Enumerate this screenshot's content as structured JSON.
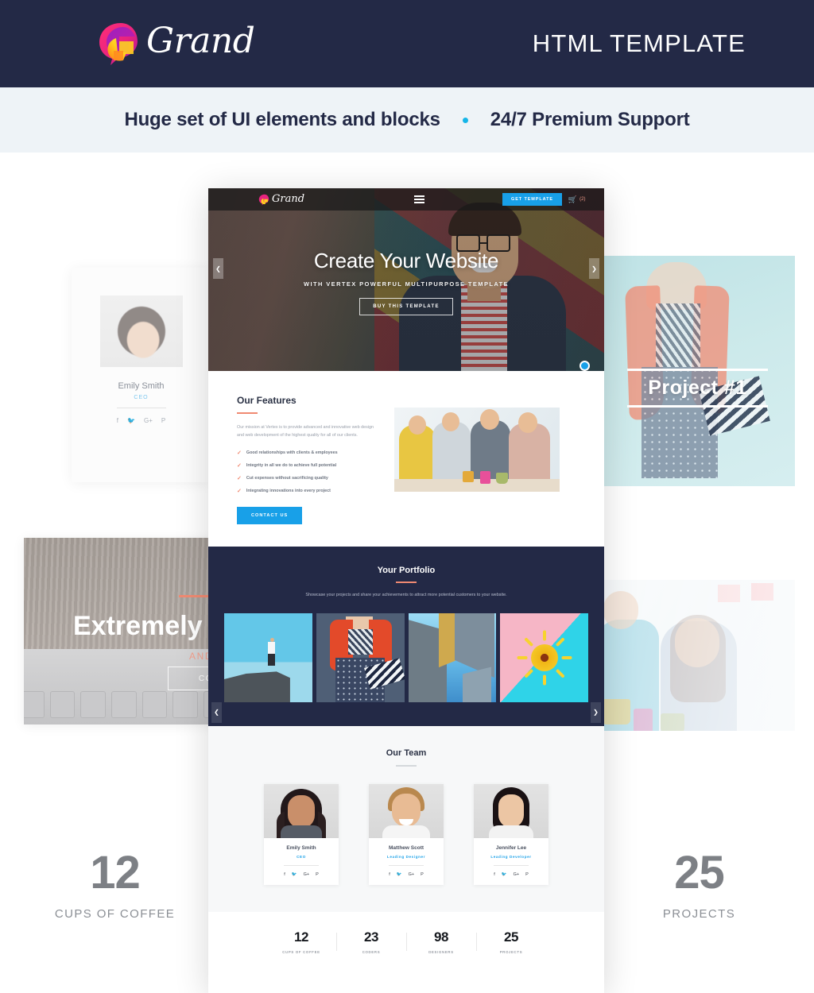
{
  "banner": {
    "brand_name": "Grand",
    "brand_icon": "grand-logo-icon",
    "tagline": "HTML TEMPLATE",
    "bg_color": "#232946"
  },
  "sub_banner": {
    "left_text": "Huge set of UI elements and blocks",
    "separator_icon": "bullet-dot-icon",
    "right_text": "24/7 Premium Support",
    "bg_color": "#eef3f7",
    "dot_color": "#16b5e8"
  },
  "background": {
    "team_card": {
      "name": "Emily Smith",
      "role": "CEO",
      "social": [
        "f",
        "𝕏",
        "G+",
        "P"
      ]
    },
    "project_card": {
      "label": "Project #1"
    },
    "wood_card": {
      "title": "Extremely",
      "subtitle": "AND RETIN",
      "button": "CONTA"
    },
    "stat_left": {
      "number": "12",
      "label": "CUPS OF COFFEE"
    },
    "stat_right": {
      "number": "25",
      "label": "PROJECTS"
    }
  },
  "mockup": {
    "nav": {
      "logo_text": "Grand",
      "logo_icon": "grand-logo-icon",
      "menu_icon": "hamburger-menu-icon",
      "cta_label": "GET TEMPLATE",
      "cart_icon": "shopping-cart-icon",
      "cart_count": "(2)",
      "cta_color": "#18a0e8"
    },
    "hero": {
      "title": "Create Your Website",
      "subtitle": "WITH VERTEX POWERFUL MULTIPURPOSE TEMPLATE",
      "button": "BUY THIS TEMPLATE",
      "prev_icon": "chevron-left-icon",
      "next_icon": "chevron-right-icon"
    },
    "features": {
      "heading": "Our Features",
      "paragraph": "Our mission at Vertex is to provide advanced and innovative web design and web development of the highest quality for all of our clients.",
      "items": [
        "Good relationships with clients & employees",
        "Integrity in all we do to achieve full potential",
        "Cut expenses without sacrificing quality",
        "Integrating innovations into every project"
      ],
      "check_icon": "check-mark-icon",
      "button": "CONTACT US",
      "accent_color": "#f08a72"
    },
    "portfolio": {
      "heading": "Your Portfolio",
      "paragraph": "Showcase your projects and share your achievements to attract more potential customers to your website.",
      "prev_icon": "chevron-left-icon",
      "next_icon": "chevron-right-icon",
      "bg_color": "#232946",
      "items": [
        {
          "name": "man-on-cliff-photo"
        },
        {
          "name": "fashion-model-photo"
        },
        {
          "name": "skyscrapers-photo"
        },
        {
          "name": "yellow-flower-photo"
        }
      ]
    },
    "team": {
      "heading": "Our Team",
      "members": [
        {
          "name": "Emily Smith",
          "role": "CEO"
        },
        {
          "name": "Matthew Scott",
          "role": "Leading Designer"
        },
        {
          "name": "Jennifer Lee",
          "role": "Leading Developer"
        }
      ],
      "social": [
        "f",
        "t",
        "G+",
        "P"
      ]
    },
    "stats": [
      {
        "number": "12",
        "label": "CUPS OF COFFEE"
      },
      {
        "number": "23",
        "label": "CODERS"
      },
      {
        "number": "98",
        "label": "DESIGNERS"
      },
      {
        "number": "25",
        "label": "PROJECTS"
      }
    ]
  }
}
